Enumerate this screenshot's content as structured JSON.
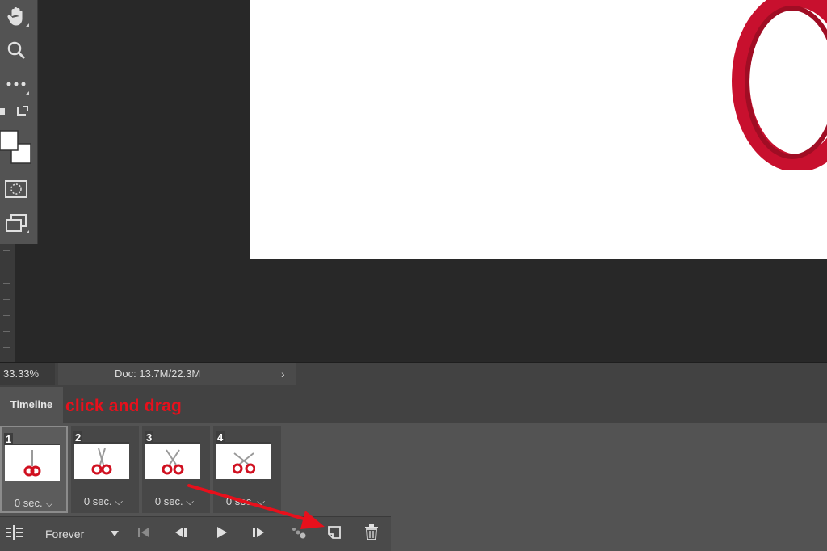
{
  "status": {
    "zoom": "33.33%",
    "doc_info": "Doc: 13.7M/22.3M"
  },
  "timeline": {
    "tab_label": "Timeline",
    "annotation": "click and drag",
    "frames": [
      {
        "number": "1",
        "delay": "0 sec.",
        "selected": true
      },
      {
        "number": "2",
        "delay": "0 sec.",
        "selected": false
      },
      {
        "number": "3",
        "delay": "0 sec.",
        "selected": false
      },
      {
        "number": "4",
        "delay": "0 sec.",
        "selected": false
      }
    ],
    "loop_option": "Forever"
  },
  "colors": {
    "accent_red": "#e8101c",
    "panel_bg": "#535353",
    "canvas_bg": "#282828"
  },
  "icons": [
    "hand-icon",
    "zoom-icon",
    "more-tools-icon",
    "swap-colors-icon",
    "foreground-background-icon",
    "quick-mask-icon",
    "screen-mode-icon",
    "timeline-menu-icon",
    "first-frame-icon",
    "previous-frame-icon",
    "play-icon",
    "next-frame-icon",
    "tween-icon",
    "duplicate-frame-icon",
    "trash-icon",
    "scissors-icon"
  ]
}
